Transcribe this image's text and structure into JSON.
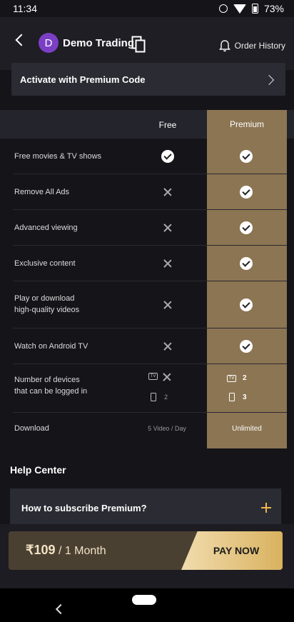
{
  "status_bar": {
    "time": "11:34",
    "battery": "73%"
  },
  "header": {
    "avatar_letter": "D",
    "account_name": "Demo Trading",
    "order_history": "Order History"
  },
  "premium_code": {
    "label": "Activate with Premium Code"
  },
  "comparison": {
    "columns": {
      "free": "Free",
      "premium": "Premium"
    },
    "rows": [
      {
        "label": "Free movies & TV shows",
        "free": "check",
        "premium": "check"
      },
      {
        "label": "Remove All Ads",
        "free": "cross",
        "premium": "check"
      },
      {
        "label": "Advanced viewing",
        "free": "cross",
        "premium": "check"
      },
      {
        "label": "Exclusive content",
        "free": "cross",
        "premium": "check"
      },
      {
        "label_line1": "Play or download",
        "label_line2": "high-quality videos",
        "free": "cross",
        "premium": "check"
      },
      {
        "label": "Watch on Android TV",
        "free": "cross",
        "premium": "check"
      }
    ],
    "devices": {
      "label_line1": "Number of devices",
      "label_line2": "that can be logged in",
      "tv_label": "TV",
      "free_phone": "2",
      "premium_tv": "2",
      "premium_phone": "3"
    },
    "download": {
      "label": "Download",
      "free": "5 Video / Day",
      "premium": "Unlimited"
    }
  },
  "help_center": {
    "title": "Help Center",
    "faq": "How to subscribe Premium?"
  },
  "purchase": {
    "price": "₹109",
    "period": "/ 1 Month",
    "button": "PAY NOW"
  },
  "colors": {
    "premium_column": "#8c7553",
    "accent": "#f0b64a",
    "background": "#141419"
  }
}
